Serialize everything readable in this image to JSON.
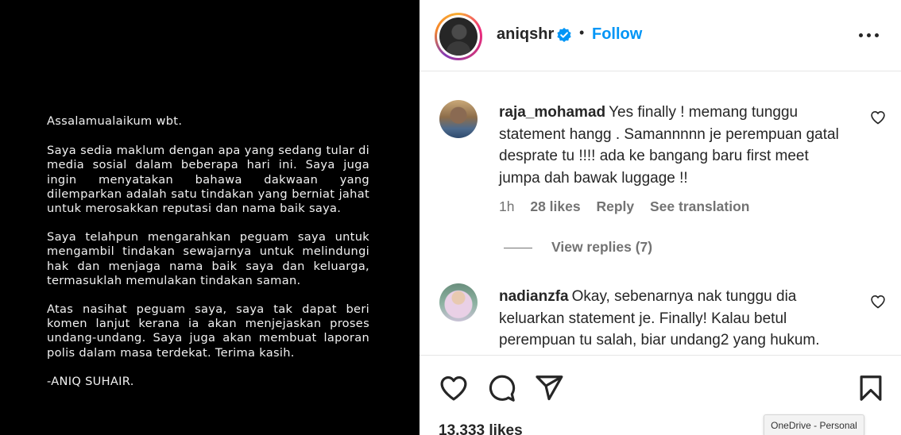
{
  "post_image": {
    "statement": [
      "Assalamualaikum wbt.",
      "Saya sedia maklum dengan apa yang sedang tular di media sosial dalam beberapa hari ini. Saya juga ingin menyatakan bahawa dakwaan yang dilemparkan adalah satu tindakan yang berniat jahat untuk merosakkan reputasi dan nama baik saya.",
      "Saya telahpun mengarahkan peguam saya untuk mengambil tindakan sewajarnya untuk melindungi hak dan menjaga nama baik saya dan keluarga, termasuklah memulakan tindakan saman.",
      "Atas nasihat peguam saya, saya tak dapat beri komen lanjut kerana ia akan menjejaskan proses undang-undang. Saya juga akan membuat laporan polis dalam masa terdekat. Terima kasih.",
      "-ANIQ SUHAIR."
    ]
  },
  "header": {
    "username": "aniqshr",
    "separator": "•",
    "follow_label": "Follow",
    "icons": {
      "verified": "verified-badge-icon",
      "more": "more-options-icon"
    },
    "colors": {
      "follow": "#0095f6",
      "verified": "#0095f6"
    }
  },
  "comments": [
    {
      "username": "raja_mohamad",
      "text": "Yes finally ! memang tunggu statement hangg . Samannnnn je perempuan gatal desprate tu !!!! ada ke bangang baru first meet jumpa dah bawak luggage !!",
      "time": "1h",
      "likes": "28 likes",
      "reply_label": "Reply",
      "translate_label": "See translation",
      "view_replies": "View replies (7)"
    },
    {
      "username": "nadianzfa",
      "text": "Okay, sebenarnya nak tunggu dia keluarkan statement je. Finally! Kalau betul perempuan tu salah, biar undang2 yang hukum."
    }
  ],
  "actions": {
    "icons": [
      "heart-icon",
      "comment-icon",
      "share-icon",
      "bookmark-icon"
    ],
    "likes_count": "13,333 likes"
  },
  "toast": {
    "text": "OneDrive - Personal"
  }
}
